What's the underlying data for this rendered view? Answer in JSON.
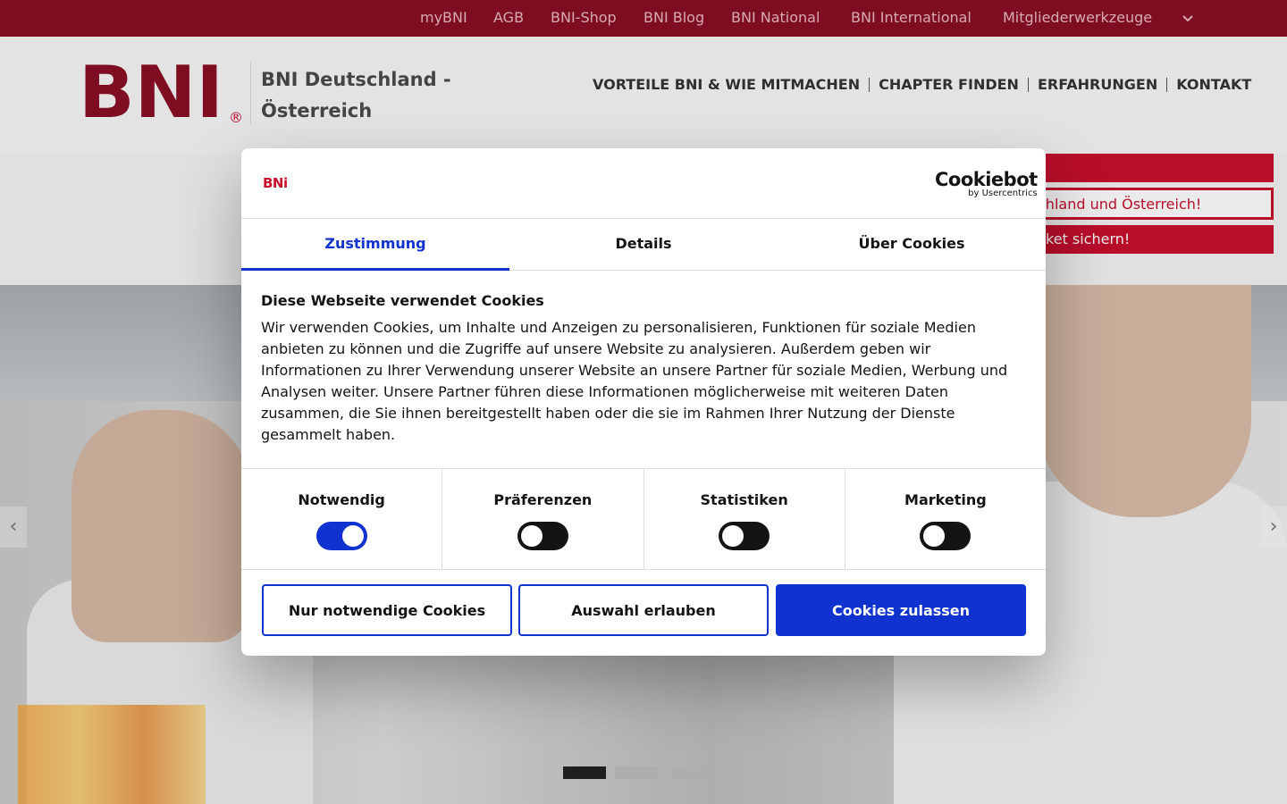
{
  "topbar": {
    "links": [
      "myBNI",
      "AGB",
      "BNI-Shop",
      "BNI Blog",
      "BNI National",
      "BNI International",
      "Mitgliederwerkzeuge"
    ]
  },
  "header": {
    "logo_text": "BNI",
    "registered_mark": "®",
    "site_title": "BNI Deutschland - Österreich",
    "nav": [
      "VORTEILE BNI & WIE MITMACHEN",
      "CHAPTER FINDEN",
      "ERFAHRUNGEN",
      "KONTAKT"
    ]
  },
  "promo": {
    "line2": "chland und Österreich!",
    "line3": "ket sichern!"
  },
  "cookie_dialog": {
    "brand": "BNi",
    "vendor_logo": "Cookiebot",
    "vendor_sub": "by Usercentrics",
    "tabs": [
      "Zustimmung",
      "Details",
      "Über Cookies"
    ],
    "active_tab": "Zustimmung",
    "heading": "Diese Webseite verwendet Cookies",
    "body": "Wir verwenden Cookies, um Inhalte und Anzeigen zu personalisieren, Funktionen für soziale Medien anbieten zu können und die Zugriffe auf unsere Website zu analysieren. Außerdem geben wir Informationen zu Ihrer Verwendung unserer Website an unsere Partner für soziale Medien, Werbung und Analysen weiter. Unsere Partner führen diese Informationen möglicherweise mit weiteren Daten zusammen, die Sie ihnen bereitgestellt haben oder die sie im Rahmen Ihrer Nutzung der Dienste gesammelt haben.",
    "categories": [
      {
        "label": "Notwendig",
        "enabled": true
      },
      {
        "label": "Präferenzen",
        "enabled": false
      },
      {
        "label": "Statistiken",
        "enabled": false
      },
      {
        "label": "Marketing",
        "enabled": false
      }
    ],
    "buttons": {
      "necessary_only": "Nur notwendige Cookies",
      "allow_selection": "Auswahl erlauben",
      "allow_all": "Cookies zulassen"
    }
  },
  "carousel": {
    "slide_count": 3,
    "active_slide": 1,
    "prev_glyph": "‹",
    "next_glyph": "›"
  },
  "colors": {
    "brand_red": "#c8102e",
    "topbar_red": "#8a0f24",
    "cookiebot_blue": "#1032cf"
  }
}
